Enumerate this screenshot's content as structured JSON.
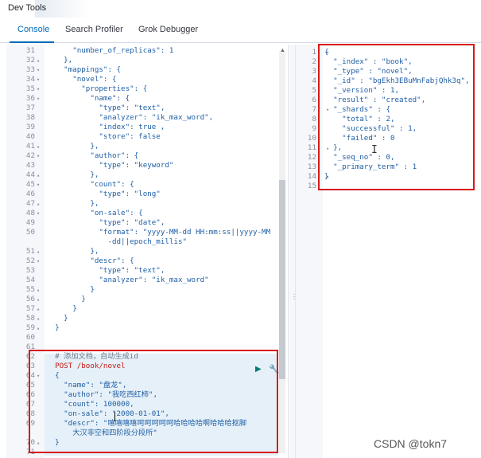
{
  "window": {
    "title": "Dev Tools"
  },
  "tabs": [
    {
      "label": "Console",
      "active": true
    },
    {
      "label": "Search Profiler",
      "active": false
    },
    {
      "label": "Grok Debugger",
      "active": false
    }
  ],
  "editor": {
    "lines": [
      {
        "n": "31",
        "fold": "",
        "text": "      \"number_of_replicas\": 1"
      },
      {
        "n": "32",
        "fold": "▴",
        "text": "    },"
      },
      {
        "n": "33",
        "fold": "▾",
        "text": "    \"mappings\": {"
      },
      {
        "n": "34",
        "fold": "▾",
        "text": "      \"novel\": {"
      },
      {
        "n": "35",
        "fold": "▾",
        "text": "        \"properties\": {"
      },
      {
        "n": "36",
        "fold": "▾",
        "text": "          \"name\": {"
      },
      {
        "n": "37",
        "fold": "",
        "text": "            \"type\": \"text\","
      },
      {
        "n": "38",
        "fold": "",
        "text": "            \"analyzer\": \"ik_max_word\","
      },
      {
        "n": "39",
        "fold": "",
        "text": "            \"index\": true ,"
      },
      {
        "n": "40",
        "fold": "",
        "text": "            \"store\": false"
      },
      {
        "n": "41",
        "fold": "▴",
        "text": "          },"
      },
      {
        "n": "42",
        "fold": "▾",
        "text": "          \"author\": {"
      },
      {
        "n": "43",
        "fold": "",
        "text": "            \"type\": \"keyword\""
      },
      {
        "n": "44",
        "fold": "▴",
        "text": "          },"
      },
      {
        "n": "45",
        "fold": "▾",
        "text": "          \"count\": {"
      },
      {
        "n": "46",
        "fold": "",
        "text": "            \"type\": \"long\""
      },
      {
        "n": "47",
        "fold": "▴",
        "text": "          },"
      },
      {
        "n": "48",
        "fold": "▾",
        "text": "          \"on-sale\": {"
      },
      {
        "n": "49",
        "fold": "",
        "text": "            \"type\": \"date\","
      },
      {
        "n": "50",
        "fold": "",
        "text": "            \"format\": \"yyyy-MM-dd HH:mm:ss||yyyy-MM"
      },
      {
        "n": "",
        "fold": "",
        "text": "              -dd||epoch_millis\""
      },
      {
        "n": "51",
        "fold": "▴",
        "text": "          },"
      },
      {
        "n": "52",
        "fold": "▾",
        "text": "          \"descr\": {"
      },
      {
        "n": "53",
        "fold": "",
        "text": "            \"type\": \"text\","
      },
      {
        "n": "54",
        "fold": "",
        "text": "            \"analyzer\": \"ik_max_word\""
      },
      {
        "n": "55",
        "fold": "▴",
        "text": "          }"
      },
      {
        "n": "56",
        "fold": "▴",
        "text": "        }"
      },
      {
        "n": "57",
        "fold": "▴",
        "text": "      }"
      },
      {
        "n": "58",
        "fold": "▴",
        "text": "    }"
      },
      {
        "n": "59",
        "fold": "▴",
        "text": "  }"
      },
      {
        "n": "60",
        "fold": "",
        "text": ""
      },
      {
        "n": "61",
        "fold": "",
        "text": ""
      },
      {
        "n": "62",
        "fold": "",
        "text": "  # 添加文档，自动生成id"
      },
      {
        "n": "63",
        "fold": "",
        "text": "  POST /book/novel"
      },
      {
        "n": "64",
        "fold": "▾",
        "text": "  {"
      },
      {
        "n": "65",
        "fold": "",
        "text": "    \"name\": \"盘龙\","
      },
      {
        "n": "66",
        "fold": "",
        "text": "    \"author\": \"我吃西红柿\","
      },
      {
        "n": "67",
        "fold": "",
        "text": "    \"count\": 100000,"
      },
      {
        "n": "68",
        "fold": "",
        "text": "    \"on-sale\": \"2000-01-01\","
      },
      {
        "n": "69",
        "fold": "",
        "text": "    \"descr\": \"嘻嘻嘻嘻呵呵呵呵呵哈哈哈哈啊哈哈哈抠脚"
      },
      {
        "n": "",
        "fold": "",
        "text": "      大汉非空和四阶段分段所\""
      },
      {
        "n": "70",
        "fold": "▴",
        "text": "  }"
      },
      {
        "n": "71",
        "fold": "",
        "text": ""
      }
    ]
  },
  "response": {
    "lines": [
      {
        "n": "1",
        "fold": "▾",
        "text": "{"
      },
      {
        "n": "2",
        "fold": "",
        "text": "  \"_index\" : \"book\","
      },
      {
        "n": "3",
        "fold": "",
        "text": "  \"_type\" : \"novel\","
      },
      {
        "n": "4",
        "fold": "",
        "text": "  \"_id\" : \"bgEkh3EBuMnFabjQhk3q\","
      },
      {
        "n": "5",
        "fold": "",
        "text": "  \"_version\" : 1,"
      },
      {
        "n": "6",
        "fold": "",
        "text": "  \"result\" : \"created\","
      },
      {
        "n": "7",
        "fold": "▾",
        "text": "  \"_shards\" : {"
      },
      {
        "n": "8",
        "fold": "",
        "text": "    \"total\" : 2,"
      },
      {
        "n": "9",
        "fold": "",
        "text": "    \"successful\" : 1,"
      },
      {
        "n": "10",
        "fold": "",
        "text": "    \"failed\" : 0"
      },
      {
        "n": "11",
        "fold": "▴",
        "text": "  },"
      },
      {
        "n": "12",
        "fold": "",
        "text": "  \"_seq_no\" : 0,"
      },
      {
        "n": "13",
        "fold": "",
        "text": "  \"_primary_term\" : 1"
      },
      {
        "n": "14",
        "fold": "▴",
        "text": "}"
      },
      {
        "n": "15",
        "fold": "",
        "text": ""
      }
    ]
  },
  "icons": {
    "run": "play-icon",
    "settings": "wrench-icon",
    "panel_resize": "resize-handle-icon"
  },
  "watermark": "CSDN @tokn7",
  "colors": {
    "accent": "#006bb4",
    "highlight_box": "#d71a1a",
    "run": "#017d73"
  }
}
